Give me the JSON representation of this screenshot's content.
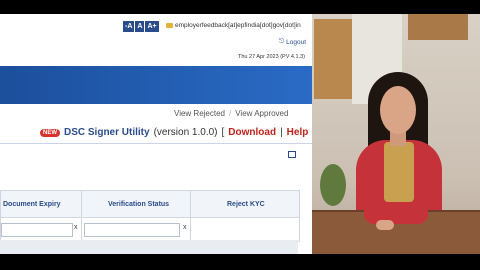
{
  "header": {
    "font_buttons": [
      "-A",
      "A",
      "A+"
    ],
    "feedback_email": "employerfeedback[at]epfindia[dot]gov[dot]in",
    "logout": "Logout",
    "datetime": "Thu 27 Apr 2023 (PV 4.1.3)"
  },
  "views": {
    "rejected": "View Rejected",
    "separator": "/",
    "approved": "View Approved"
  },
  "dsc": {
    "new_badge": "NEW",
    "name": "DSC Signer Utility",
    "version": "(version 1.0.0)",
    "open_bracket": "[",
    "download": "Download",
    "pipe": "|",
    "help": "Help",
    "close_bracket": "]"
  },
  "grid": {
    "columns": [
      "Document Expiry",
      "Verification Status",
      "Reject KYC"
    ],
    "clear_glyph": "x"
  },
  "colors": {
    "nav_blue": "#1c4f9c",
    "link_red": "#c0211b",
    "header_text": "#2a4c8a"
  }
}
